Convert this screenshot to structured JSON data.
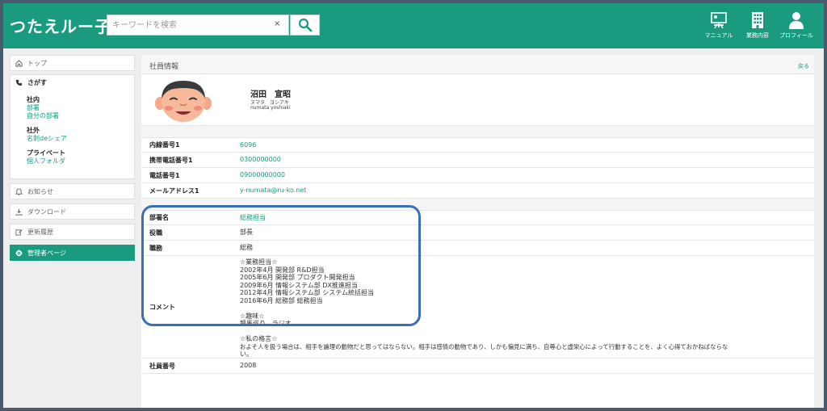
{
  "header": {
    "logo": "つたえルー子",
    "search": {
      "placeholder": "キーワードを検索",
      "clear": "×"
    },
    "icons": [
      {
        "name": "manual-icon",
        "label": "マニュアル"
      },
      {
        "name": "business-icon",
        "label": "業務内容"
      },
      {
        "name": "profile-icon",
        "label": "プロフィール"
      }
    ]
  },
  "sidebar": {
    "top": "トップ",
    "search_label": "さがす",
    "categories": [
      {
        "title": "社内",
        "links": [
          "部署",
          "自分の部署"
        ]
      },
      {
        "title": "社外",
        "links": [
          "名刺deシェア"
        ]
      },
      {
        "title": "プライベート",
        "links": [
          "個人フォルダ"
        ]
      }
    ],
    "notice": "お知らせ",
    "download": "ダウンロード",
    "history": "更新履歴",
    "admin": "管理者ページ"
  },
  "main": {
    "title": "社員情報",
    "back": "戻る",
    "profile": {
      "name": "沼田　宣昭",
      "kana": "ヌマタ　ヨシアキ",
      "roman": "numata yoshiaki"
    },
    "contact": [
      {
        "label": "内線番号1",
        "value": "6096",
        "link": true
      },
      {
        "label": "携帯電話番号1",
        "value": "0300000000",
        "link": true
      },
      {
        "label": "電話番号1",
        "value": "09000000000",
        "link": true
      },
      {
        "label": "メールアドレス1",
        "value": "y-numata@ru-ko.net",
        "link": true
      }
    ],
    "org": [
      {
        "label": "部署名",
        "value": "総務担当",
        "link": true
      },
      {
        "label": "役職",
        "value": "部長",
        "link": false
      },
      {
        "label": "職務",
        "value": "総務",
        "link": false
      }
    ],
    "comment": {
      "label": "コメント",
      "lines": [
        "☆業務担当☆",
        "2002年4月 開発部 R&D担当",
        "2005年6月 開発部 プロダクト開発担当",
        "2009年6月 情報システム部 DX推進担当",
        "2012年4月 情報システム部 システム統括担当",
        "2016年6月 総務部 総務担当",
        "",
        "☆趣味☆",
        "競馬巡り、ラジオ",
        "",
        "☆私の格言☆",
        "およそ人を扱う場合は、相手を論理の動物だと思ってはならない。相手は感情の動物であり、しかも偏見に満ち、自尊心と虚栄心によって行動することを、よく心得ておかねばならな",
        "い。"
      ]
    },
    "employee_no": {
      "label": "社員番号",
      "value": "2008"
    }
  },
  "colors": {
    "brand": "#1a9b7f",
    "highlight": "#3a6fb8"
  }
}
